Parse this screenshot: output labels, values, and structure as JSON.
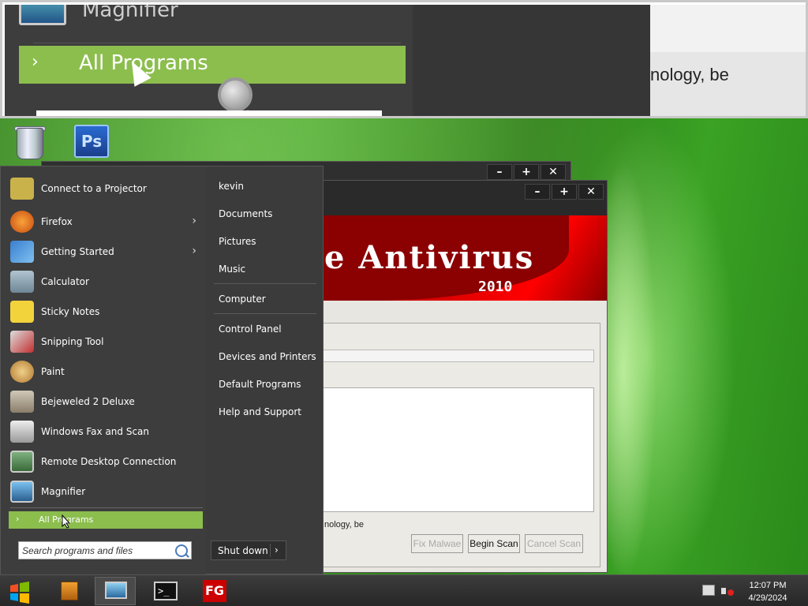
{
  "magnifier": {
    "label": "Magnifier",
    "all_programs": "All Programs",
    "right_text": "nology, be"
  },
  "desktop": {
    "icons": [
      {
        "name": "Recycle Bin",
        "icon": "recycle-bin-icon"
      },
      {
        "name": "Photoshop",
        "icon": "photoshop-icon",
        "glyph": "Ps"
      }
    ]
  },
  "back_window": {
    "controls": [
      "–",
      "+",
      "✕"
    ]
  },
  "antivirus": {
    "controls": [
      "–",
      "+",
      "✕"
    ],
    "banner_title": "e Antivirus",
    "banner_year": "2010",
    "status_text": "nology, be",
    "buttons": {
      "fix": "Fix Malwae",
      "begin": "Begin Scan",
      "cancel": "Cancel Scan"
    }
  },
  "start_menu": {
    "programs": [
      {
        "label": "Connect to a Projector",
        "icon": "projector-icon",
        "color": "#c9b24a",
        "submenu": false
      },
      {
        "label": "Firefox",
        "icon": "firefox-icon",
        "color": "#e8741c",
        "submenu": true
      },
      {
        "label": "Getting Started",
        "icon": "getting-started-icon",
        "color": "#3a7fd0",
        "submenu": true
      },
      {
        "label": "Calculator",
        "icon": "calculator-icon",
        "color": "#8aa0b0",
        "submenu": false
      },
      {
        "label": "Sticky Notes",
        "icon": "sticky-notes-icon",
        "color": "#f2d33c",
        "submenu": false
      },
      {
        "label": "Snipping Tool",
        "icon": "scissors-icon",
        "color": "#c23030",
        "submenu": false
      },
      {
        "label": "Paint",
        "icon": "paint-palette-icon",
        "color": "#e0b060",
        "submenu": false
      },
      {
        "label": "Bejeweled 2 Deluxe",
        "icon": "bejeweled-icon",
        "color": "#b0a090",
        "submenu": false
      },
      {
        "label": "Windows Fax and Scan",
        "icon": "fax-icon",
        "color": "#c0c0c0",
        "submenu": false
      },
      {
        "label": "Remote Desktop Connection",
        "icon": "remote-desktop-icon",
        "color": "#5a8a5a",
        "submenu": false
      },
      {
        "label": "Magnifier",
        "icon": "magnifier-icon",
        "color": "#4a90c0",
        "submenu": false
      }
    ],
    "all_programs": "All Programs",
    "search_placeholder": "Search programs and files",
    "links": [
      "kevin",
      "Documents",
      "Pictures",
      "Music",
      "Computer",
      "Control Panel",
      "Devices and Printers",
      "Default Programs",
      "Help and Support"
    ],
    "shutdown": "Shut down"
  },
  "taskbar": {
    "time": "12:07 PM",
    "date": "4/29/2024",
    "apps": [
      {
        "icon": "start-orb-icon"
      },
      {
        "icon": "file-cabinet-icon"
      },
      {
        "icon": "remote-desktop-icon"
      },
      {
        "icon": "terminal-icon",
        "glyph": ">_"
      },
      {
        "icon": "fg-app-icon",
        "glyph": "FG"
      }
    ]
  }
}
